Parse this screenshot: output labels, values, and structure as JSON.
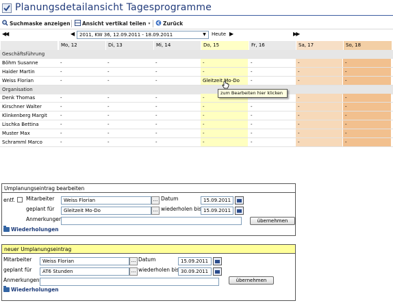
{
  "title": "Planungsdetailansicht Tagesprogramme",
  "toolbar": {
    "search_mask": "Suchmaske anzeigen",
    "split_view": "Ansicht vertikal teilen",
    "back": "Zurück"
  },
  "nav": {
    "week_selected": "2011, KW 36, 12.09.2011 - 18.09.2011",
    "today": "Heute"
  },
  "days": [
    "Mo, 12",
    "Di, 13",
    "Mi, 14",
    "Do, 15",
    "Fr, 16",
    "Sa, 17",
    "So, 18"
  ],
  "groups": [
    {
      "name": "Geschäftsführung",
      "people": [
        {
          "name": "Böhm Susanne",
          "cells": [
            "-",
            "-",
            "-",
            "-",
            "-",
            "-",
            "-"
          ]
        },
        {
          "name": "Haider Martin",
          "cells": [
            "-",
            "-",
            "-",
            "-",
            "-",
            "-",
            "-"
          ]
        },
        {
          "name": "Weiss Florian",
          "cells": [
            "-",
            "-",
            "-",
            "Gleitzeit Mo-Do",
            "-",
            "-",
            "-"
          ]
        }
      ]
    },
    {
      "name": "Organisation",
      "people": [
        {
          "name": "Denk Thomas",
          "cells": [
            "-",
            "-",
            "-",
            "-",
            "-",
            "-",
            "-"
          ]
        },
        {
          "name": "Kirschner Walter",
          "cells": [
            "-",
            "-",
            "-",
            "-",
            "-",
            "-",
            "-"
          ]
        },
        {
          "name": "Klinkenberg Margit",
          "cells": [
            "-",
            "-",
            "-",
            "-",
            "-",
            "-",
            "-"
          ]
        },
        {
          "name": "Lischka Bettina",
          "cells": [
            "-",
            "-",
            "-",
            "-",
            "-",
            "-",
            "-"
          ]
        },
        {
          "name": "Muster Max",
          "cells": [
            "-",
            "-",
            "-",
            "-",
            "-",
            "-",
            "-"
          ]
        },
        {
          "name": "Schramml Marco",
          "cells": [
            "-",
            "-",
            "-",
            "-",
            "-",
            "-",
            "-"
          ]
        }
      ]
    }
  ],
  "tooltip": "zum Bearbeiten hier klicken",
  "edit_panel": {
    "header": "Umplanungseintrag bearbeiten",
    "entf": "entf.",
    "mitarbeiter_label": "Mitarbeiter",
    "mitarbeiter_value": "Weiss Florian",
    "datum_label": "Datum",
    "datum_value": "15.09.2011",
    "geplant_label": "geplant für",
    "geplant_value": "Gleitzeit Mo-Do",
    "wiederholen_label": "wiederholen bis",
    "wiederholen_value": "15.09.2011",
    "anmerkungen_label": "Anmerkungen",
    "anmerkungen_value": "",
    "submit": "übernehmen",
    "repeats": "Wiederholungen"
  },
  "new_panel": {
    "header": "neuer Umplanungseintrag",
    "mitarbeiter_label": "Mitarbeiter",
    "mitarbeiter_value": "Weiss Florian",
    "datum_label": "Datum",
    "datum_value": "15.09.2011",
    "geplant_label": "geplant für",
    "geplant_value": "AT6 Stunden",
    "wiederholen_label": "wiederholen bis",
    "wiederholen_value": "30.09.2011",
    "anmerkungen_label": "Anmerkungen",
    "anmerkungen_value": "",
    "submit": "übernehmen",
    "repeats": "Wiederholungen"
  },
  "colors": {
    "title": "#203a7a",
    "today_column": "#ffffc0",
    "saturday_column": "#f7d9b9",
    "sunday_column": "#f2c08e",
    "new_panel_header": "#ffff99"
  }
}
